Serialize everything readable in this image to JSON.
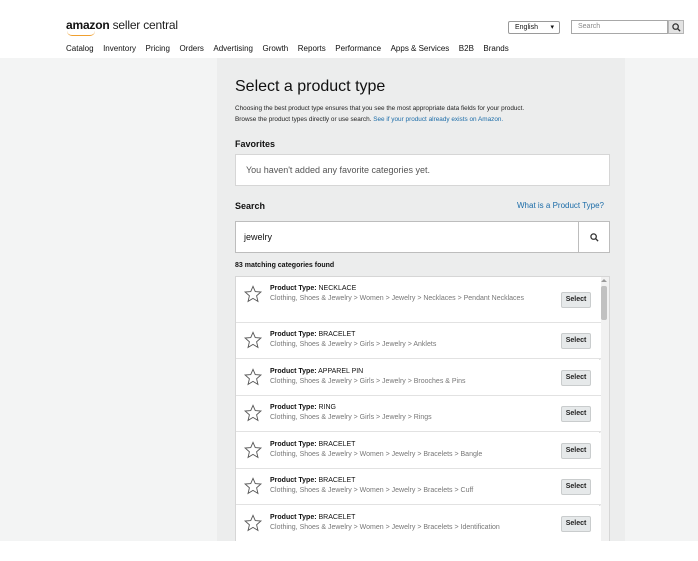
{
  "header": {
    "logo_brand": "amazon",
    "logo_rest": " seller central",
    "language": "English",
    "search_placeholder": "Search",
    "nav": [
      "Catalog",
      "Inventory",
      "Pricing",
      "Orders",
      "Advertising",
      "Growth",
      "Reports",
      "Performance",
      "Apps & Services",
      "B2B",
      "Brands"
    ]
  },
  "page": {
    "title": "Select a product type",
    "description_line1": "Choosing the best product type ensures that you see the most appropriate data fields for your product.",
    "description_line2": "Browse the product types directly or use search. ",
    "description_link": "See if your product already exists on Amazon.",
    "favorites_heading": "Favorites",
    "favorites_empty": "You haven't added any favorite categories yet.",
    "search_heading": "Search",
    "what_link": "What is a Product Type?",
    "search_value": "jewelry",
    "count_text": "83 matching categories found",
    "select_label": "Select",
    "product_type_label": "Product Type:"
  },
  "results": [
    {
      "type": "NECKLACE",
      "path": "Clothing, Shoes & Jewelry > Women > Jewelry > Necklaces > Pendant Necklaces"
    },
    {
      "type": "BRACELET",
      "path": "Clothing, Shoes & Jewelry > Girls > Jewelry > Anklets"
    },
    {
      "type": "APPAREL PIN",
      "path": "Clothing, Shoes & Jewelry > Girls > Jewelry > Brooches & Pins"
    },
    {
      "type": "RING",
      "path": "Clothing, Shoes & Jewelry > Girls > Jewelry > Rings"
    },
    {
      "type": "BRACELET",
      "path": "Clothing, Shoes & Jewelry > Women > Jewelry > Bracelets > Bangle"
    },
    {
      "type": "BRACELET",
      "path": "Clothing, Shoes & Jewelry > Women > Jewelry > Bracelets > Cuff"
    },
    {
      "type": "BRACELET",
      "path": "Clothing, Shoes & Jewelry > Women > Jewelry > Bracelets > Identification"
    }
  ],
  "colors": {
    "link": "#1b6ca8",
    "accent": "#f0a030"
  }
}
